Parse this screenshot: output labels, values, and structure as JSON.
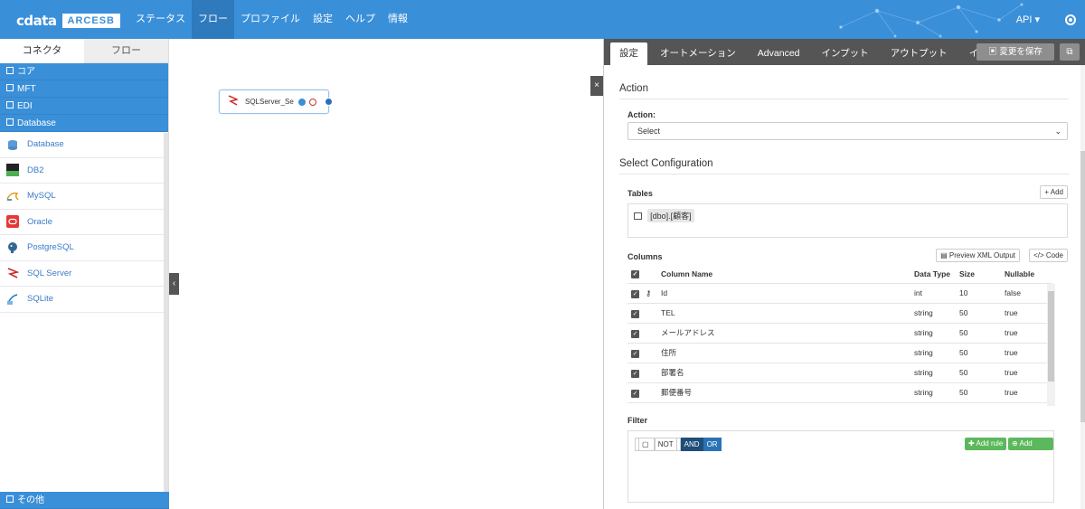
{
  "app": {
    "logo_main": "cdata",
    "logo_box": "ARCESB"
  },
  "nav": {
    "items": [
      "ステータス",
      "フロー",
      "プロファイル",
      "設定",
      "ヘルプ",
      "情報"
    ],
    "api_label": "API ▾"
  },
  "left_panel": {
    "tabs": [
      "コネクタ",
      "フロー"
    ],
    "categories": [
      "コア",
      "MFT",
      "EDI",
      "Database"
    ],
    "connectors": [
      "Database",
      "DB2",
      "MySQL",
      "Oracle",
      "PostgreSQL",
      "SQL Server",
      "SQLite"
    ],
    "bottom_category": "その他"
  },
  "canvas": {
    "node_label": "SQLServer_Se...",
    "close_glyph": "×",
    "collapse_glyph": "‹"
  },
  "right_panel": {
    "tabs": [
      "設定",
      "オートメーション",
      "Advanced",
      "インプット",
      "アウトプット",
      "イベント"
    ],
    "save_label": "変更を保存",
    "action_section": "Action",
    "action_label": "Action:",
    "action_value": "Select",
    "select_config_title": "Select Configuration",
    "tables_label": "Tables",
    "add_label": "+ Add",
    "table_tag": "[dbo].[顧客]",
    "columns_label": "Columns",
    "preview_xml_label": "Preview XML Output",
    "code_label": "</> Code",
    "columns_headers": [
      "Column Name",
      "Data Type",
      "Size",
      "Nullable"
    ],
    "columns_rows": [
      {
        "name": "Id",
        "type": "int",
        "size": "10",
        "nullable": "false",
        "key": true
      },
      {
        "name": "TEL",
        "type": "string",
        "size": "50",
        "nullable": "true",
        "key": false
      },
      {
        "name": "メールアドレス",
        "type": "string",
        "size": "50",
        "nullable": "true",
        "key": false
      },
      {
        "name": "住所",
        "type": "string",
        "size": "50",
        "nullable": "true",
        "key": false
      },
      {
        "name": "部署名",
        "type": "string",
        "size": "50",
        "nullable": "true",
        "key": false
      },
      {
        "name": "郵便番号",
        "type": "string",
        "size": "50",
        "nullable": "true",
        "key": false
      }
    ],
    "filter_label": "Filter",
    "filter_not": "NOT",
    "filter_and": "AND",
    "filter_or": "OR",
    "add_rule": "Add rule",
    "add_group": "Add group"
  },
  "colors": {
    "brand_blue": "#3a8fd9",
    "dark_tab": "#555555",
    "green_btn": "#5cb85c"
  }
}
